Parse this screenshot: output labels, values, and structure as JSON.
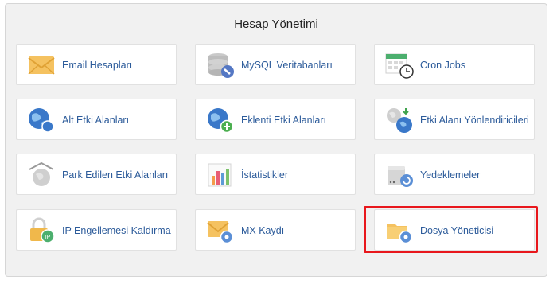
{
  "panel": {
    "title": "Hesap Yönetimi"
  },
  "tiles": [
    {
      "label": "Email Hesapları"
    },
    {
      "label": "MySQL Veritabanları"
    },
    {
      "label": "Cron Jobs"
    },
    {
      "label": "Alt Etki Alanları"
    },
    {
      "label": "Eklenti Etki Alanları"
    },
    {
      "label": "Etki Alanı Yönlendiricileri"
    },
    {
      "label": "Park Edilen Etki Alanları"
    },
    {
      "label": "İstatistikler"
    },
    {
      "label": "Yedeklemeler"
    },
    {
      "label": "IP Engellemesi Kaldırma"
    },
    {
      "label": "MX Kaydı"
    },
    {
      "label": "Dosya Yöneticisi"
    }
  ],
  "icons": {
    "ip_badge": "IP"
  },
  "colors": {
    "link": "#2c5b9a",
    "highlight": "#e8171c",
    "panel_bg": "#f1f1f1"
  }
}
